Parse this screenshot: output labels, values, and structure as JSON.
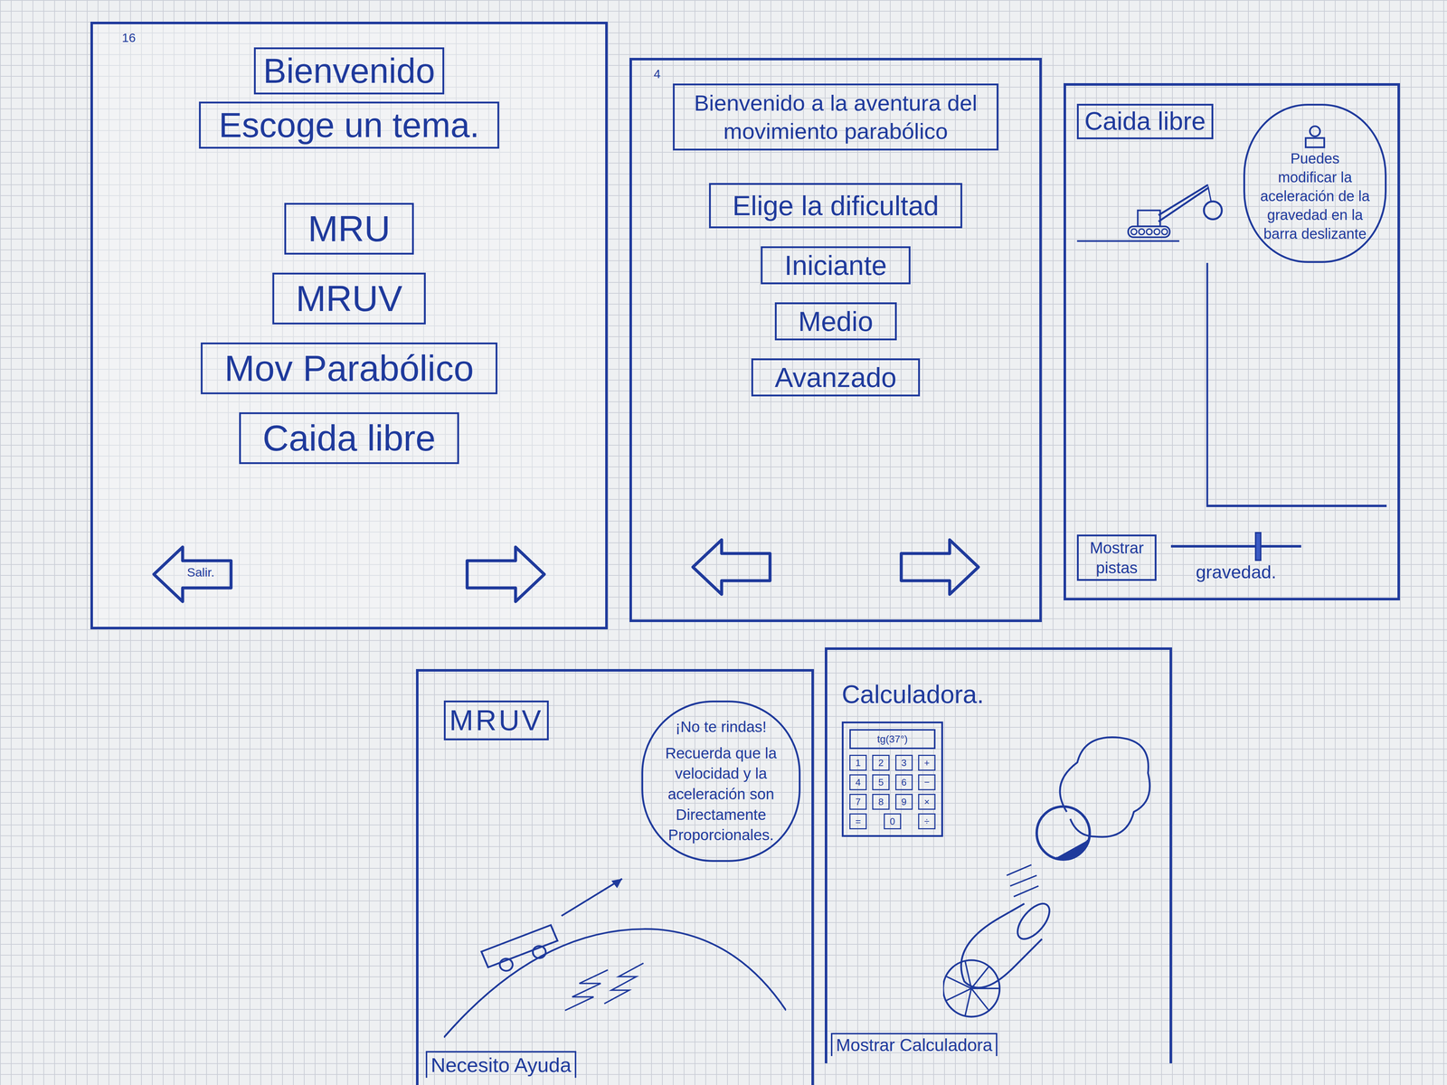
{
  "menu_screen": {
    "page": "16",
    "title": "Bienvenido",
    "subtitle": "Escoge un tema.",
    "topics": [
      {
        "label": "MRU"
      },
      {
        "label": "MRUV"
      },
      {
        "label": "Mov Parabólico"
      },
      {
        "label": "Caida libre"
      }
    ],
    "back_label": "Salir."
  },
  "difficulty_screen": {
    "page": "4",
    "title": "Bienvenido a la aventura del movimiento parabólico",
    "prompt": "Elige la dificultad",
    "levels": [
      {
        "label": "Iniciante"
      },
      {
        "label": "Medio"
      },
      {
        "label": "Avanzado"
      }
    ]
  },
  "free_fall_screen": {
    "title": "Caida libre",
    "tip": "Puedes modificar la aceleración de la gravedad en la barra deslizante",
    "hints_button": "Mostrar pistas",
    "slider": {
      "label": "gravedad.",
      "level": 0.67
    }
  },
  "mruv_screen": {
    "title": "MRUV",
    "tip_heading": "¡No te rindas!",
    "tip": "Recuerda que la velocidad y la aceleración son Directamente Proporcionales.",
    "help_button": "Necesito Ayuda"
  },
  "calculator_screen": {
    "title": "Calculadora.",
    "display": "tg(37°)",
    "keys": [
      [
        "1",
        "2",
        "3",
        "+"
      ],
      [
        "4",
        "5",
        "6",
        "−"
      ],
      [
        "7",
        "8",
        "9",
        "×"
      ],
      [
        "=",
        "0",
        "÷"
      ]
    ],
    "show_button": "Mostrar Calculadora"
  }
}
